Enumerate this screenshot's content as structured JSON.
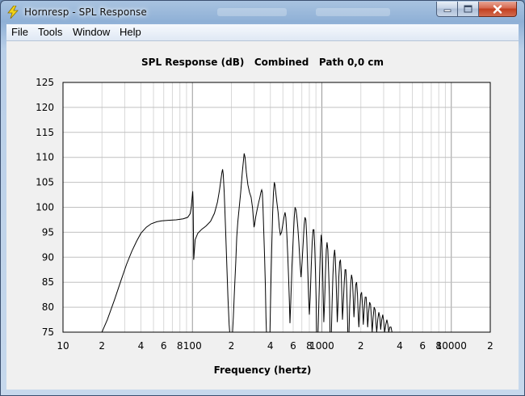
{
  "window": {
    "title": "Hornresp - SPL Response",
    "controls": {
      "minimize_icon": "minimize-icon",
      "maximize_icon": "maximize-icon",
      "close_icon": "close-icon"
    }
  },
  "menu": {
    "items": [
      {
        "label": "File"
      },
      {
        "label": "Tools"
      },
      {
        "label": "Window"
      },
      {
        "label": "Help"
      }
    ]
  },
  "chart_data": {
    "type": "line",
    "title": "SPL Response (dB)   Combined   Path 0,0 cm",
    "xlabel": "Frequency (hertz)",
    "ylabel": "",
    "x_scale": "log",
    "xlim": [
      10,
      20000
    ],
    "ylim": [
      75,
      125
    ],
    "grid": true,
    "x_tick_labels": [
      "10",
      "2",
      "4",
      "6",
      "8",
      "100",
      "2",
      "4",
      "6",
      "8",
      "1000",
      "2",
      "4",
      "6",
      "8",
      "10000",
      "2"
    ],
    "x_tick_values": [
      10,
      20,
      40,
      60,
      80,
      100,
      200,
      400,
      600,
      800,
      1000,
      2000,
      4000,
      6000,
      8000,
      10000,
      20000
    ],
    "y_tick_labels": [
      "75",
      "80",
      "85",
      "90",
      "95",
      "100",
      "105",
      "110",
      "115",
      "120",
      "125"
    ],
    "series": [
      {
        "color": "#000000",
        "points": [
          [
            20,
            75
          ],
          [
            22,
            77.5
          ],
          [
            25,
            81.5
          ],
          [
            28,
            85.3
          ],
          [
            31,
            88.6
          ],
          [
            34,
            91.2
          ],
          [
            37,
            93.2
          ],
          [
            40,
            94.8
          ],
          [
            44,
            96
          ],
          [
            48,
            96.7
          ],
          [
            53,
            97.1
          ],
          [
            58,
            97.3
          ],
          [
            65,
            97.4
          ],
          [
            75,
            97.5
          ],
          [
            85,
            97.7
          ],
          [
            92,
            98
          ],
          [
            96,
            98.7
          ],
          [
            98,
            100
          ],
          [
            99.5,
            102
          ],
          [
            100.5,
            103.2
          ],
          [
            101.2,
            101
          ],
          [
            101.8,
            95
          ],
          [
            102.2,
            89.5
          ],
          [
            103,
            90.5
          ],
          [
            105,
            93.5
          ],
          [
            110,
            94.8
          ],
          [
            118,
            95.6
          ],
          [
            128,
            96.3
          ],
          [
            138,
            97.2
          ],
          [
            148,
            98.8
          ],
          [
            156,
            101
          ],
          [
            162,
            103.5
          ],
          [
            166,
            105.5
          ],
          [
            169,
            107
          ],
          [
            171,
            107.6
          ],
          [
            173,
            106.6
          ],
          [
            176,
            103
          ],
          [
            180,
            96
          ],
          [
            184,
            89
          ],
          [
            188,
            82
          ],
          [
            192,
            76.5
          ],
          [
            194,
            75
          ],
          [
            204,
            75
          ],
          [
            207,
            78
          ],
          [
            211,
            83
          ],
          [
            216,
            89
          ],
          [
            220,
            94
          ],
          [
            224,
            97
          ],
          [
            229,
            99.5
          ],
          [
            236,
            103
          ],
          [
            243,
            107
          ],
          [
            248,
            109.5
          ],
          [
            251,
            110.8
          ],
          [
            255,
            110
          ],
          [
            261,
            107
          ],
          [
            268,
            104.5
          ],
          [
            276,
            103
          ],
          [
            284,
            102
          ],
          [
            291,
            100
          ],
          [
            296,
            97.5
          ],
          [
            299,
            96
          ],
          [
            302,
            96.5
          ],
          [
            308,
            98
          ],
          [
            316,
            99.5
          ],
          [
            325,
            101
          ],
          [
            332,
            102
          ],
          [
            338,
            103
          ],
          [
            343,
            103.5
          ],
          [
            347,
            103
          ],
          [
            351,
            100
          ],
          [
            356,
            95
          ],
          [
            361,
            90
          ],
          [
            366,
            84
          ],
          [
            370,
            78
          ],
          [
            373,
            75
          ],
          [
            397,
            75
          ],
          [
            400,
            79
          ],
          [
            405,
            86
          ],
          [
            411,
            93
          ],
          [
            417,
            99
          ],
          [
            423,
            103
          ],
          [
            429,
            105
          ],
          [
            434,
            104.5
          ],
          [
            440,
            103
          ],
          [
            449,
            101
          ],
          [
            459,
            99
          ],
          [
            469,
            96
          ],
          [
            478,
            94.5
          ],
          [
            488,
            95
          ],
          [
            499,
            96.5
          ],
          [
            510,
            98
          ],
          [
            519,
            99
          ],
          [
            527,
            98
          ],
          [
            535,
            95
          ],
          [
            544,
            91
          ],
          [
            553,
            86
          ],
          [
            561,
            81
          ],
          [
            567,
            76.8
          ],
          [
            575,
            81
          ],
          [
            587,
            88
          ],
          [
            601,
            94
          ],
          [
            612,
            98
          ],
          [
            621,
            100
          ],
          [
            631,
            99.5
          ],
          [
            641,
            98
          ],
          [
            652,
            96
          ],
          [
            664,
            93
          ],
          [
            677,
            89
          ],
          [
            690,
            86
          ],
          [
            703,
            89
          ],
          [
            717,
            93
          ],
          [
            730,
            96.5
          ],
          [
            741,
            98
          ],
          [
            752,
            97.5
          ],
          [
            764,
            94
          ],
          [
            777,
            88
          ],
          [
            790,
            82
          ],
          [
            800,
            78.5
          ],
          [
            813,
            82
          ],
          [
            827,
            88
          ],
          [
            841,
            93
          ],
          [
            855,
            95.5
          ],
          [
            868,
            95.5
          ],
          [
            881,
            92
          ],
          [
            893,
            87
          ],
          [
            904,
            81
          ],
          [
            911,
            75
          ],
          [
            935,
            75
          ],
          [
            948,
            81
          ],
          [
            962,
            87
          ],
          [
            976,
            92
          ],
          [
            989,
            94.5
          ],
          [
            1001,
            93
          ],
          [
            1013,
            88
          ],
          [
            1025,
            82
          ],
          [
            1035,
            77
          ],
          [
            1050,
            81
          ],
          [
            1066,
            87
          ],
          [
            1082,
            91.5
          ],
          [
            1097,
            93
          ],
          [
            1112,
            91.5
          ],
          [
            1128,
            87
          ],
          [
            1144,
            82
          ],
          [
            1156,
            75
          ],
          [
            1184,
            75
          ],
          [
            1200,
            81
          ],
          [
            1218,
            86.5
          ],
          [
            1236,
            90
          ],
          [
            1254,
            91.5
          ],
          [
            1270,
            90
          ],
          [
            1286,
            86
          ],
          [
            1302,
            81
          ],
          [
            1316,
            77
          ],
          [
            1334,
            81
          ],
          [
            1352,
            86
          ],
          [
            1372,
            89
          ],
          [
            1391,
            89.5
          ],
          [
            1409,
            87
          ],
          [
            1427,
            82
          ],
          [
            1443,
            77.5
          ],
          [
            1465,
            81
          ],
          [
            1488,
            85
          ],
          [
            1510,
            87.5
          ],
          [
            1532,
            87.5
          ],
          [
            1553,
            84.5
          ],
          [
            1572,
            79.5
          ],
          [
            1587,
            75
          ],
          [
            1620,
            75
          ],
          [
            1640,
            80
          ],
          [
            1668,
            84.5
          ],
          [
            1695,
            86.5
          ],
          [
            1720,
            85.5
          ],
          [
            1745,
            82
          ],
          [
            1768,
            78
          ],
          [
            1796,
            81
          ],
          [
            1826,
            84.5
          ],
          [
            1855,
            85
          ],
          [
            1883,
            82.5
          ],
          [
            1909,
            78.5
          ],
          [
            1930,
            76
          ],
          [
            1961,
            79.5
          ],
          [
            1996,
            82.5
          ],
          [
            2029,
            83
          ],
          [
            2060,
            80.5
          ],
          [
            2089,
            76.5
          ],
          [
            2123,
            79.5
          ],
          [
            2160,
            82
          ],
          [
            2196,
            82
          ],
          [
            2229,
            79.5
          ],
          [
            2258,
            76
          ],
          [
            2297,
            79
          ],
          [
            2338,
            81
          ],
          [
            2377,
            80.5
          ],
          [
            2412,
            78
          ],
          [
            2446,
            75
          ],
          [
            2490,
            78
          ],
          [
            2535,
            80
          ],
          [
            2577,
            79.5
          ],
          [
            2616,
            77
          ],
          [
            2652,
            75
          ],
          [
            2704,
            77.5
          ],
          [
            2755,
            79
          ],
          [
            2804,
            78
          ],
          [
            2848,
            75.5
          ],
          [
            2900,
            77.5
          ],
          [
            2956,
            78.5
          ],
          [
            3008,
            77
          ],
          [
            3055,
            75
          ],
          [
            3115,
            76.5
          ],
          [
            3177,
            77.5
          ],
          [
            3233,
            76.5
          ],
          [
            3285,
            75
          ],
          [
            3350,
            76
          ],
          [
            3420,
            76
          ],
          [
            3480,
            75
          ]
        ]
      }
    ]
  }
}
